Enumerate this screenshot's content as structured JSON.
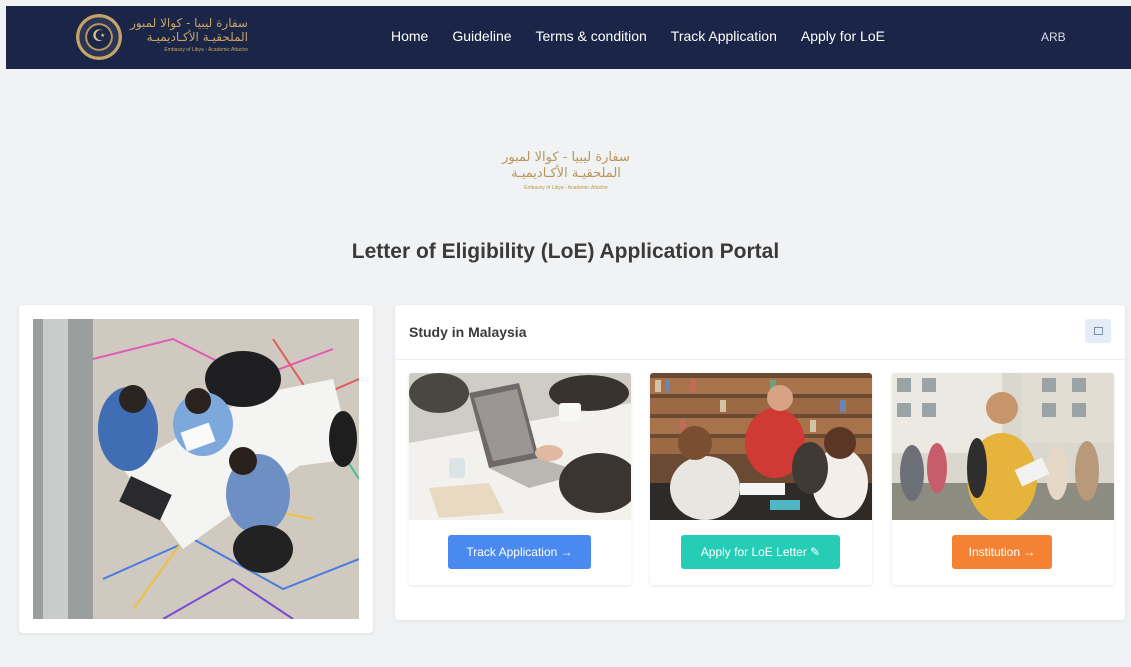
{
  "header": {
    "logo_arabic_line1": "سفارة ليبيا - كوالا لمبور",
    "logo_arabic_line2": "الملحقيـة الأكـاديميـة",
    "logo_english": "Embassy of Libya - Academic Attache",
    "nav": [
      "Home",
      "Guideline",
      "Terms & condition",
      "Track Application",
      "Apply for LoE"
    ],
    "language_toggle": "ARB"
  },
  "hero": {
    "logo_arabic_line1": "سفارة ليبيا - كوالا لمبور",
    "logo_arabic_line2": "الملحقيـة الأكـاديميـة",
    "logo_english": "Embassy of Libya - Academic Attache",
    "title": "Letter of Eligibility (LoE) Application Portal"
  },
  "panel": {
    "title": "Study in Malaysia",
    "tiles": [
      {
        "button": "Track Application",
        "icon": "arrow-right-icon",
        "color": "#4a8af0"
      },
      {
        "button": "Apply for LoE Letter",
        "icon": "pencil-icon",
        "color": "#26cdb6"
      },
      {
        "button": "Institution",
        "icon": "arrow-right-icon",
        "color": "#f58232"
      }
    ]
  },
  "colors": {
    "navbar": "#1a2547",
    "gold": "#b8955c",
    "background": "#f1f2f3"
  }
}
